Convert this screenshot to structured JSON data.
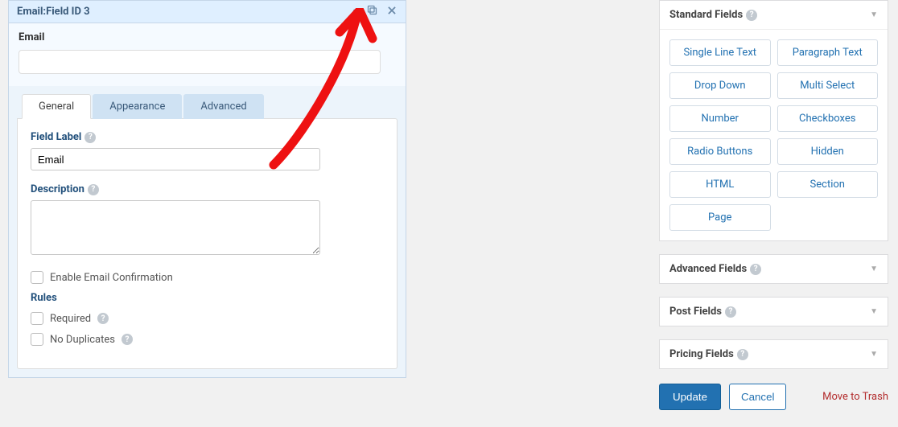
{
  "panel": {
    "header_prefix": "Email",
    "header_sep": " : ",
    "header_id": "Field ID 3",
    "preview_label": "Email"
  },
  "tabs": {
    "general": "General",
    "appearance": "Appearance",
    "advanced": "Advanced"
  },
  "settings": {
    "field_label_title": "Field Label",
    "field_label_value": "Email",
    "description_title": "Description",
    "description_value": "",
    "enable_confirm": "Enable Email Confirmation",
    "rules_title": "Rules",
    "required": "Required",
    "noduplicates": "No Duplicates"
  },
  "sidebar": {
    "standard": {
      "title": "Standard Fields",
      "items": [
        "Single Line Text",
        "Paragraph Text",
        "Drop Down",
        "Multi Select",
        "Number",
        "Checkboxes",
        "Radio Buttons",
        "Hidden",
        "HTML",
        "Section",
        "Page"
      ]
    },
    "advanced_title": "Advanced Fields",
    "post_title": "Post Fields",
    "pricing_title": "Pricing Fields"
  },
  "actions": {
    "update": "Update",
    "cancel": "Cancel",
    "trash": "Move to Trash"
  }
}
